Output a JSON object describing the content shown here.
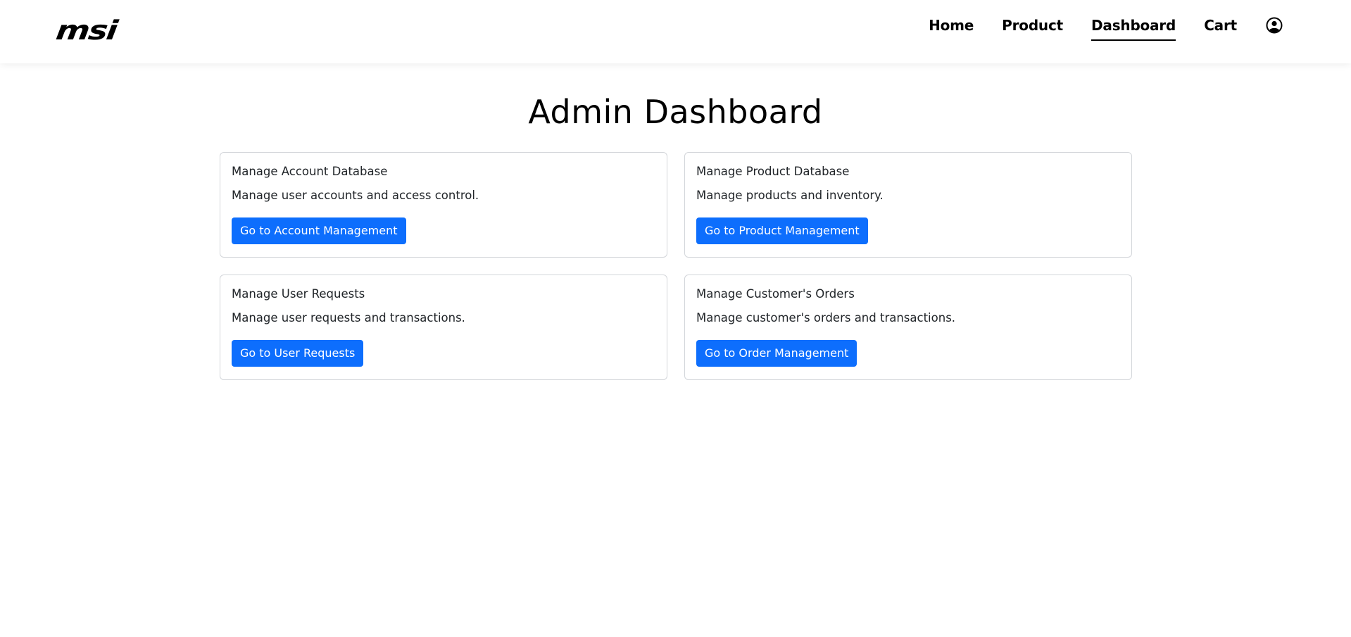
{
  "header": {
    "logo_text": "msi",
    "nav": [
      {
        "label": "Home",
        "active": false
      },
      {
        "label": "Product",
        "active": false
      },
      {
        "label": "Dashboard",
        "active": true
      },
      {
        "label": "Cart",
        "active": false
      }
    ],
    "user_icon": "user-circle-icon"
  },
  "main": {
    "title": "Admin Dashboard",
    "cards": [
      {
        "title": "Manage Account Database",
        "text": "Manage user accounts and access control.",
        "button": "Go to Account Management"
      },
      {
        "title": "Manage Product Database",
        "text": "Manage products and inventory.",
        "button": "Go to Product Management"
      },
      {
        "title": "Manage User Requests",
        "text": "Manage user requests and transactions.",
        "button": "Go to User Requests"
      },
      {
        "title": "Manage Customer's Orders",
        "text": "Manage customer's orders and transactions.",
        "button": "Go to Order Management"
      }
    ]
  },
  "colors": {
    "accent": "#0d6efd",
    "text": "#212529",
    "card_border": "#d3d6da"
  }
}
